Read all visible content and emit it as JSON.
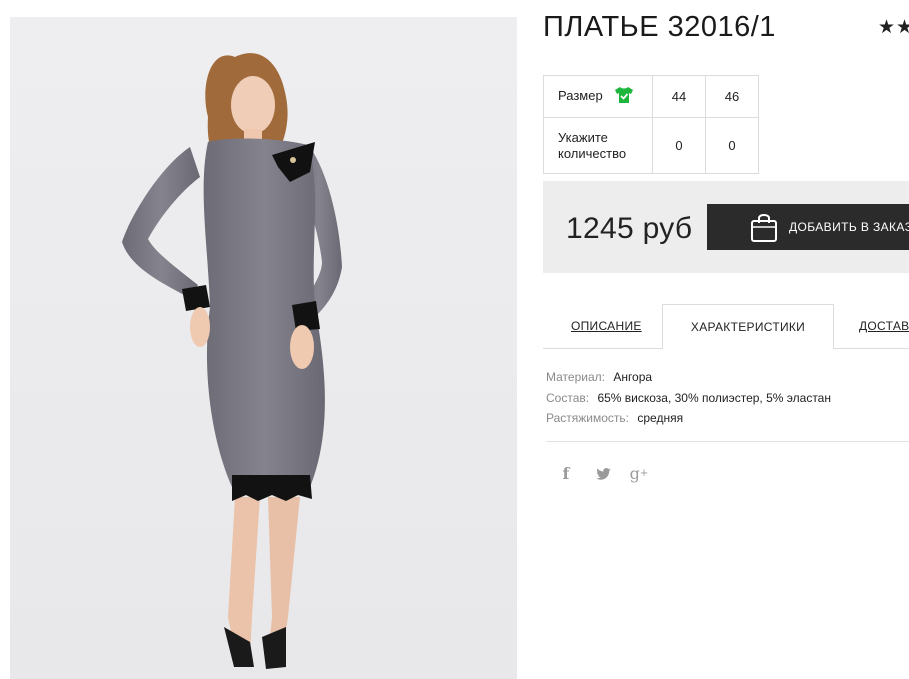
{
  "product": {
    "title": "ПЛАТЬЕ 32016/1",
    "rating_stars": "★★",
    "image_alt": "photo-of-grey-dress"
  },
  "size_table": {
    "size_label": "Размер",
    "quantity_label": "Укажите количество",
    "sizes": [
      "44",
      "46"
    ],
    "quantities": [
      "0",
      "0"
    ],
    "size_icon": "tshirt-check-icon",
    "size_icon_color": "#1db53b"
  },
  "purchase": {
    "price": "1245 руб",
    "add_button_label": "ДОБАВИТЬ В ЗАКАЗ",
    "button_icon": "shopping-bag-icon",
    "button_color": "#2b2b2b"
  },
  "tabs": [
    {
      "label": "ОПИСАНИЕ",
      "active": false
    },
    {
      "label": "ХАРАКТЕРИСТИКИ",
      "active": true
    },
    {
      "label": "ДОСТАВКА",
      "active": false
    }
  ],
  "specs": [
    {
      "key": "Материал:",
      "value": "Ангора"
    },
    {
      "key": "Состав:",
      "value": "65% вискоза, 30% полиэстер, 5% эластан"
    },
    {
      "key": "Растяжимость:",
      "value": "средняя"
    }
  ],
  "social": {
    "facebook": "f",
    "google_plus": "g"
  }
}
